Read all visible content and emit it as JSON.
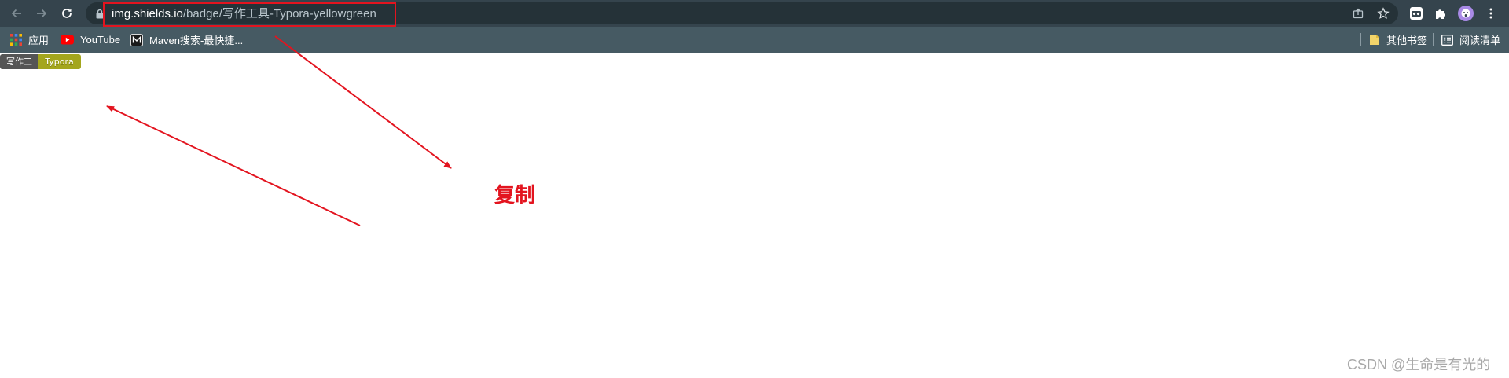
{
  "browser": {
    "url_host": "img.shields.io",
    "url_path": "/badge/写作工具-Typora-yellowgreen",
    "icons": {
      "back": "arrow-left-icon",
      "forward": "arrow-right-icon",
      "reload": "reload-icon",
      "lock": "lock-icon",
      "share": "share-icon",
      "bookmark_star": "star-icon",
      "extension1": "extension-icon",
      "puzzle": "puzzle-icon",
      "profile": "avatar",
      "menu": "kebab-menu-icon"
    }
  },
  "bookmarks": {
    "items": [
      {
        "label": "应用",
        "icon": "apps-grid-icon"
      },
      {
        "label": "YouTube",
        "icon": "youtube-icon"
      },
      {
        "label": "Maven搜索-最快捷...",
        "icon": "maven-icon"
      }
    ],
    "other_bookmarks": "其他书签",
    "reading_list": "阅读清单"
  },
  "badge": {
    "label": "写作工具",
    "message": "Typora",
    "label_color": "#555555",
    "message_color": "#a4a61d"
  },
  "annotation": {
    "text": "复制",
    "color": "#e3141f"
  },
  "watermark": "CSDN @生命是有光的"
}
